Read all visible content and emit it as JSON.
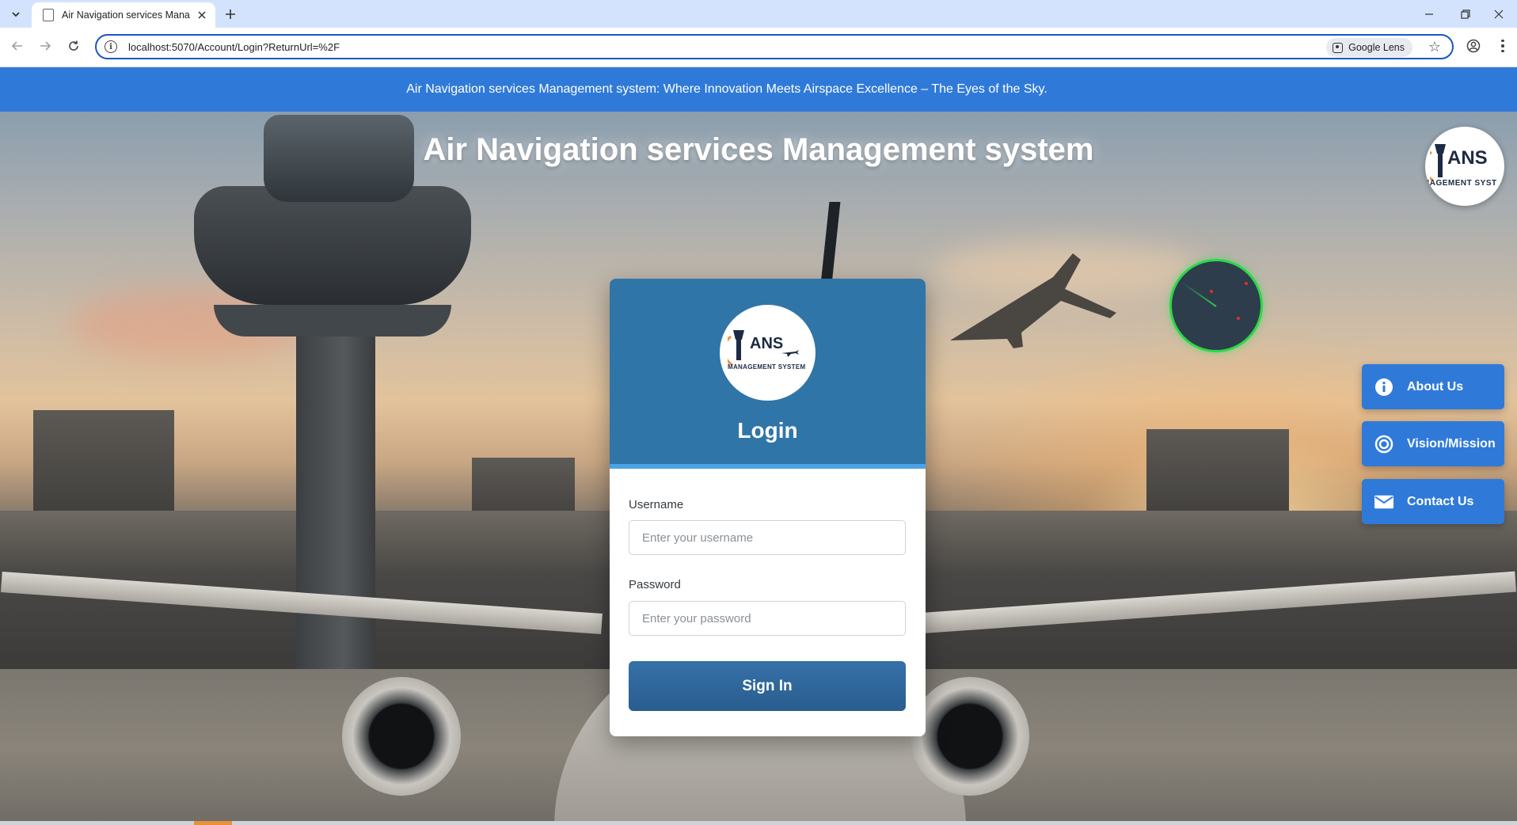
{
  "browser": {
    "tab_title": "Air Navigation services Manage",
    "url": "localhost:5070/Account/Login?ReturnUrl=%2F",
    "lens_label": "Google Lens"
  },
  "banner": {
    "text": "Air Navigation services Management system: Where Innovation Meets Airspace Excellence – The Eyes of the Sky."
  },
  "hero": {
    "title": "Air Navigation services Management system"
  },
  "logo": {
    "wordmark": "ANS",
    "tagline": "MANAGEMENT SYSTEM",
    "corner_tagline": "NAGEMENT SYST"
  },
  "side_buttons": [
    {
      "label": "About Us",
      "icon": "info-icon"
    },
    {
      "label": "Vision/Mission",
      "icon": "target-icon"
    },
    {
      "label": "Contact Us",
      "icon": "envelope-icon"
    }
  ],
  "login": {
    "title": "Login",
    "username_label": "Username",
    "username_placeholder": "Enter your username",
    "password_label": "Password",
    "password_placeholder": "Enter your password",
    "submit_label": "Sign In"
  },
  "colors": {
    "banner": "#2f7ad9",
    "card_header": "#3075a8",
    "sign_in_button": "#2a5d8f",
    "radar_ring": "#2bd84a"
  }
}
